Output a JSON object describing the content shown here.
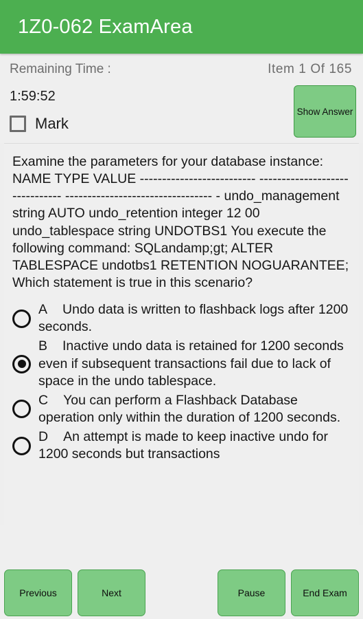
{
  "app": {
    "title": "1Z0-062 ExamArea",
    "header_color": "#4caf50",
    "button_fill": "#7ecb84",
    "button_border": "#4aa351",
    "background": "#efefef"
  },
  "status": {
    "remaining_time_label": "Remaining Time :",
    "item_counter": "Item 1 Of 165",
    "timer": "1:59:52",
    "mark_label": "Mark",
    "mark_checked": false,
    "show_answer_label": "Show Answer"
  },
  "question": {
    "stem": "Examine the parameters for your database instance: NAME TYPE VALUE -------------------------- ------------------------------- --------------------------------- - undo_management string AUTO undo_retention integer 12 00 undo_tablespace string UNDOTBS1 You execute the following command: SQLandamp;gt; ALTER TABLESPACE undotbs1 RETENTION NOGUARANTEE; Which statement is true in this scenario?",
    "selected": "B",
    "options": [
      {
        "letter": "A",
        "text": "Undo data is written to flashback logs after 1200 seconds.",
        "selected": false
      },
      {
        "letter": "B",
        "text": "Inactive undo data is retained for 1200 seconds even if subsequent transactions fail due to lack of space in the undo tablespace.",
        "selected": true
      },
      {
        "letter": "C",
        "text": "You can perform a Flashback Database operation only within the duration of 1200 seconds.",
        "selected": false
      },
      {
        "letter": "D",
        "text": "An attempt is made to keep inactive undo for 1200 seconds but transactions",
        "selected": false
      }
    ]
  },
  "footer": {
    "previous_label": "Previous",
    "next_label": "Next",
    "pause_label": "Pause",
    "end_exam_label": "End Exam"
  }
}
